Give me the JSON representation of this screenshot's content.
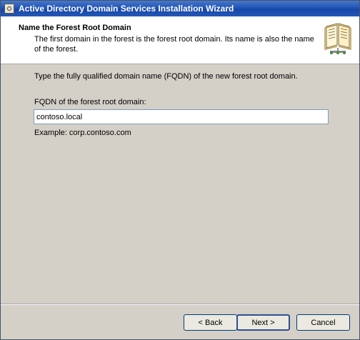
{
  "window": {
    "title": "Active Directory Domain Services Installation Wizard"
  },
  "header": {
    "title": "Name the Forest Root Domain",
    "description": "The first domain in the forest is the forest root domain. Its name is also the name of the forest.",
    "icon": "book-icon"
  },
  "main": {
    "intro_text": "Type the fully qualified domain name (FQDN) of the new forest root domain.",
    "fqdn_label": "FQDN of the forest root domain:",
    "fqdn_value": "contoso.local",
    "example_text": "Example: corp.contoso.com"
  },
  "buttons": {
    "back_label": "< Back",
    "next_label": "Next >",
    "cancel_label": "Cancel"
  },
  "colors": {
    "titlebar": "#1f55b8",
    "dialog_background": "#d4d0c8",
    "header_background": "#ffffff"
  }
}
